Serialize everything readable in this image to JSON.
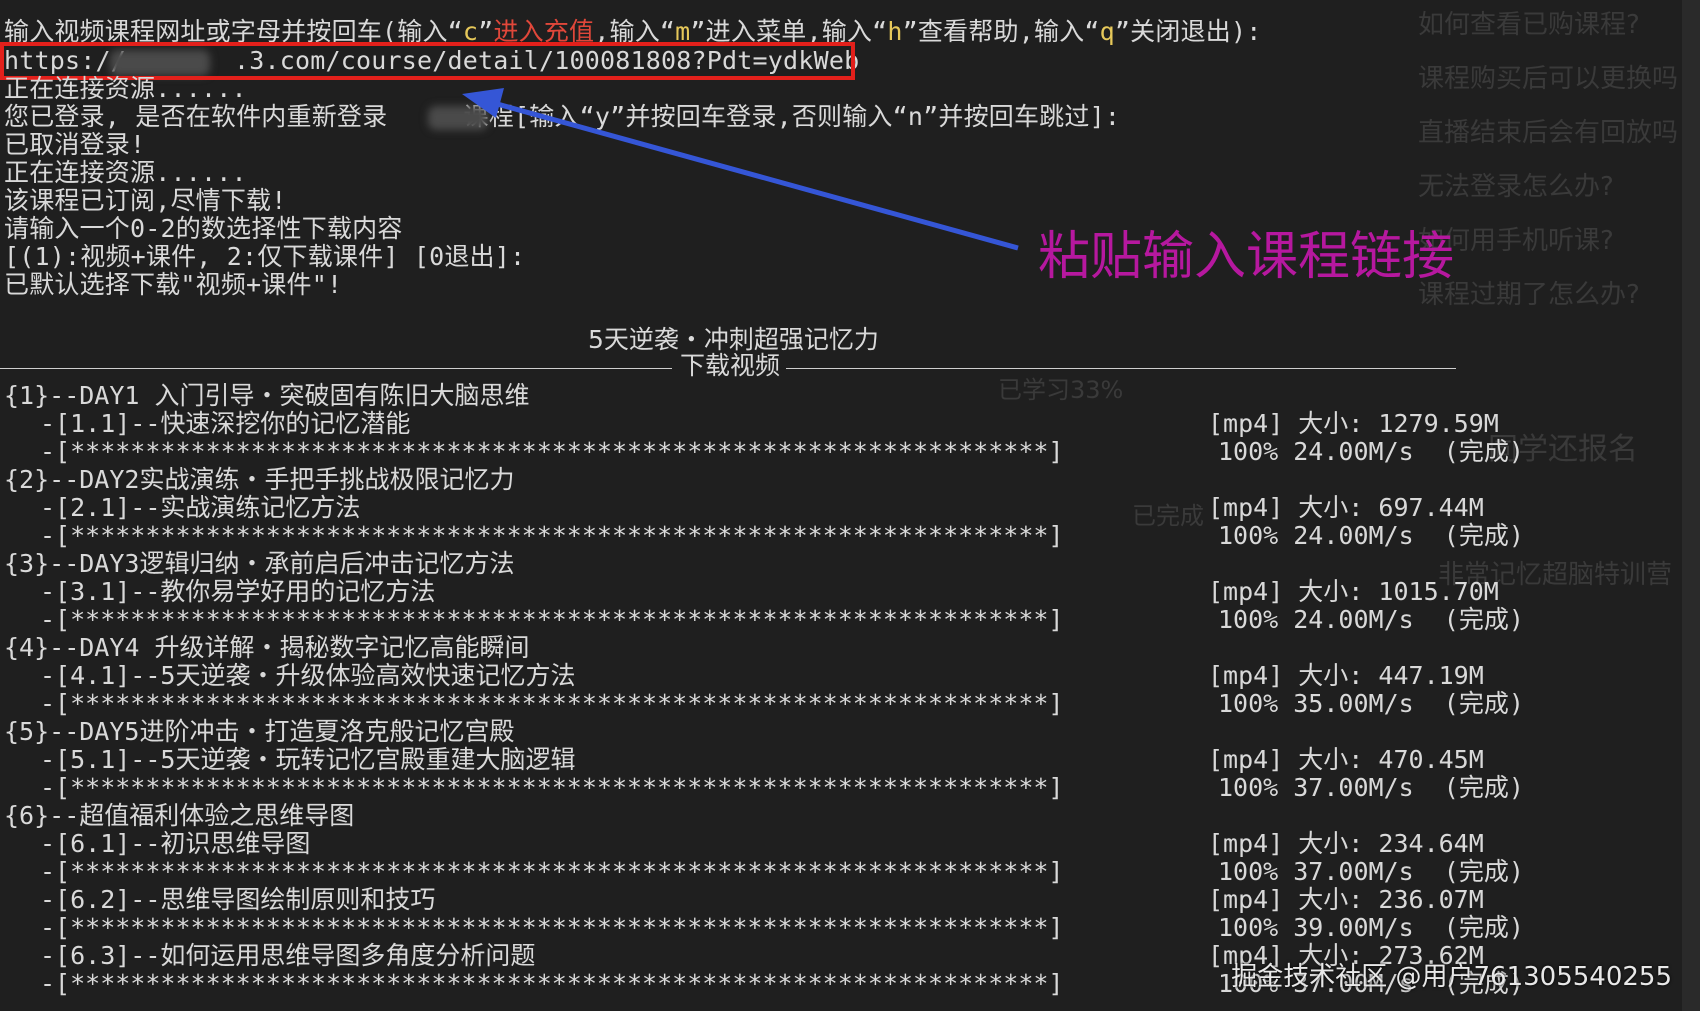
{
  "prompt": {
    "part1": "输入视频课程网址或字母并按回车(输入“",
    "key_c": "c",
    "part2": "”",
    "recharge": "进入充值",
    "part3": ",输入“",
    "key_m": "m",
    "part4": "”进入菜单,输入“",
    "key_h": "h",
    "part5": "”查看帮助,输入“",
    "key_q": "q",
    "part6": "”关闭退出):"
  },
  "url": {
    "prefix": "https://",
    "suffix": ".3.com/course/detail/100081808?Pdt=ydkWeb"
  },
  "log_lines": [
    "正在连接资源......",
    "您已登录, 是否在软件内重新登录     课程[输入“y”并按回车登录,否则输入“n”并按回车跳过]:",
    "已取消登录!",
    "正在连接资源......",
    "该课程已订阅,尽情下载!",
    "请输入一个0-2的数选择性下载内容",
    "[(1):视频+课件, 2:仅下载课件] [0退出]:",
    "已默认选择下载\"视频+课件\"!"
  ],
  "annotation": "粘贴输入课程链接",
  "course_title": "5天逆袭・冲刺超强记忆力",
  "section_label": "下载视频",
  "chapters": [
    {
      "label": "{1}--DAY1 入门引导・突破固有陈旧大脑思维",
      "lessons": [
        {
          "title": "-[1.1]--快速深挖你的记忆潜能",
          "meta": "[mp4] 大小: 1279.59M",
          "stat": "100% 24.00M/s  (完成)"
        }
      ]
    },
    {
      "label": "{2}--DAY2实战演练・手把手挑战极限记忆力",
      "lessons": [
        {
          "title": "-[2.1]--实战演练记忆方法",
          "meta": "[mp4] 大小: 697.44M",
          "stat": "100% 24.00M/s  (完成)"
        }
      ]
    },
    {
      "label": "{3}--DAY3逻辑归纳・承前启后冲击记忆方法",
      "lessons": [
        {
          "title": "-[3.1]--教你易学好用的记忆方法",
          "meta": "[mp4] 大小: 1015.70M",
          "stat": "100% 24.00M/s  (完成)"
        }
      ]
    },
    {
      "label": "{4}--DAY4 升级详解・揭秘数字记忆高能瞬间",
      "lessons": [
        {
          "title": "-[4.1]--5天逆袭・升级体验高效快速记忆方法",
          "meta": "[mp4] 大小: 447.19M",
          "stat": "100% 35.00M/s  (完成)"
        }
      ]
    },
    {
      "label": "{5}--DAY5进阶冲击・打造夏洛克般记忆宫殿",
      "lessons": [
        {
          "title": "-[5.1]--5天逆袭・玩转记忆宫殿重建大脑逻辑",
          "meta": "[mp4] 大小: 470.45M",
          "stat": "100% 37.00M/s  (完成)"
        }
      ]
    },
    {
      "label": "{6}--超值福利体验之思维导图",
      "lessons": [
        {
          "title": "-[6.1]--初识思维导图",
          "meta": "[mp4] 大小: 234.64M",
          "stat": "100% 37.00M/s  (完成)"
        },
        {
          "title": "-[6.2]--思维导图绘制原则和技巧",
          "meta": "[mp4] 大小: 236.07M",
          "stat": "100% 39.00M/s  (完成)"
        },
        {
          "title": "-[6.3]--如何运用思维导图多角度分析问题",
          "meta": "[mp4] 大小: 273.62M",
          "stat": "100% 37.00M/s  (完成)"
        }
      ]
    }
  ],
  "progress_bar": "-[*****************************************************************]",
  "watermark": "掘金技术社区 @用户761305540255",
  "background": {
    "faq": [
      "如何查看已购课程?",
      "课程购买后可以更换吗",
      "直播结束后会有回放吗",
      "无法登录怎么办?",
      "如何用手机听课?",
      "课程过期了怎么办?"
    ],
    "progress": "已学习33%",
    "enroll": "同学还报名",
    "completed": "已完成",
    "course_name": "非常记忆超脑特训营"
  },
  "colors": {
    "terminal_bg": "#1f1f1f",
    "text": "#d9d9d9",
    "key_highlight": "#e6c85a",
    "recharge": "#e0473a",
    "box": "#e3201b",
    "arrow": "#3556d6",
    "annotation": "#b6189f"
  }
}
